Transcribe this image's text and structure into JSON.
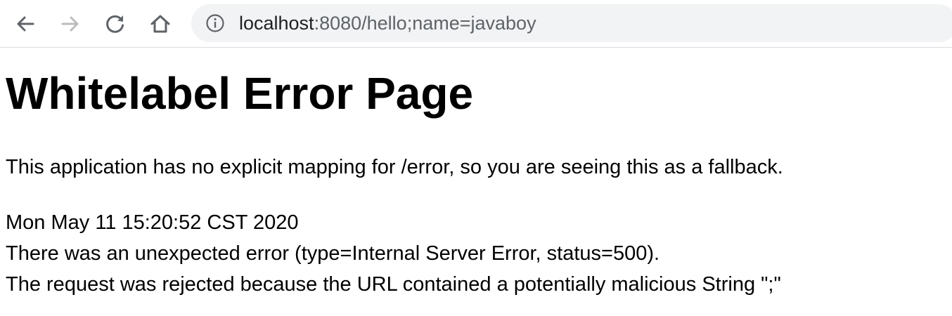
{
  "browser": {
    "address_bar": {
      "host": "localhost",
      "path": ":8080/hello;name=javaboy"
    },
    "icons": {
      "back": "arrow-left-icon",
      "forward": "arrow-right-icon",
      "reload": "reload-icon",
      "home": "home-icon",
      "site_info": "info-icon"
    },
    "colors": {
      "toolbar_bg": "#ffffff",
      "omnibox_bg": "#f1f3f4",
      "icon_active": "#5f6368",
      "icon_disabled": "#babcbe"
    }
  },
  "page": {
    "title": "Whitelabel Error Page",
    "message": "This application has no explicit mapping for /error, so you are seeing this as a fallback.",
    "timestamp": "Mon May 11 15:20:52 CST 2020",
    "error_line": "There was an unexpected error (type=Internal Server Error, status=500).",
    "detail_line": "The request was rejected because the URL contained a potentially malicious String \";\""
  }
}
